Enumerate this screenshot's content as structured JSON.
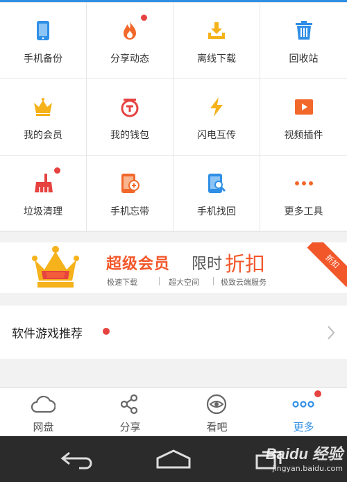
{
  "grid": {
    "items": [
      {
        "label": "手机备份",
        "icon": "phone-icon",
        "color": "#2f8fe6",
        "badge": false
      },
      {
        "label": "分享动态",
        "icon": "flame-icon",
        "color": "#f2682a",
        "badge": true
      },
      {
        "label": "离线下载",
        "icon": "download-tray-icon",
        "color": "#f5b21a",
        "badge": false
      },
      {
        "label": "回收站",
        "icon": "trash-icon",
        "color": "#2f8fe6",
        "badge": false
      },
      {
        "label": "我的会员",
        "icon": "crown-icon",
        "color": "#f5b21a",
        "badge": false
      },
      {
        "label": "我的钱包",
        "icon": "wallet-icon",
        "color": "#e64340",
        "badge": false
      },
      {
        "label": "闪电互传",
        "icon": "lightning-icon",
        "color": "#f5b21a",
        "badge": false
      },
      {
        "label": "视频插件",
        "icon": "video-play-icon",
        "color": "#f2682a",
        "badge": false
      },
      {
        "label": "垃圾清理",
        "icon": "broom-icon",
        "color": "#e64340",
        "badge": true
      },
      {
        "label": "手机忘带",
        "icon": "phone-remote-icon",
        "color": "#f2682a",
        "badge": false
      },
      {
        "label": "手机找回",
        "icon": "phone-search-icon",
        "color": "#2f8fe6",
        "badge": false
      },
      {
        "label": "更多工具",
        "icon": "more-dots-icon",
        "color": "#f2682a",
        "badge": false
      }
    ]
  },
  "banner": {
    "title_part1": "超级会员",
    "title_part2": "限时",
    "title_part3": "折扣",
    "features": [
      "极速下载",
      "超大空间",
      "极致云端服务"
    ],
    "ribbon": "折扣",
    "accent": "#f2572a"
  },
  "recommend": {
    "label": "软件游戏推荐",
    "badge": true
  },
  "tabbar": {
    "tabs": [
      {
        "label": "网盘",
        "icon": "cloud-icon",
        "active": false
      },
      {
        "label": "分享",
        "icon": "share-icon",
        "active": false
      },
      {
        "label": "看吧",
        "icon": "eye-icon",
        "active": false
      },
      {
        "label": "更多",
        "icon": "more-dots-icon",
        "active": true,
        "badge": true
      }
    ],
    "active_color": "#2f8fe6"
  },
  "watermark": {
    "line1": "Baidu 经验",
    "line2": "jingyan.baidu.com"
  }
}
